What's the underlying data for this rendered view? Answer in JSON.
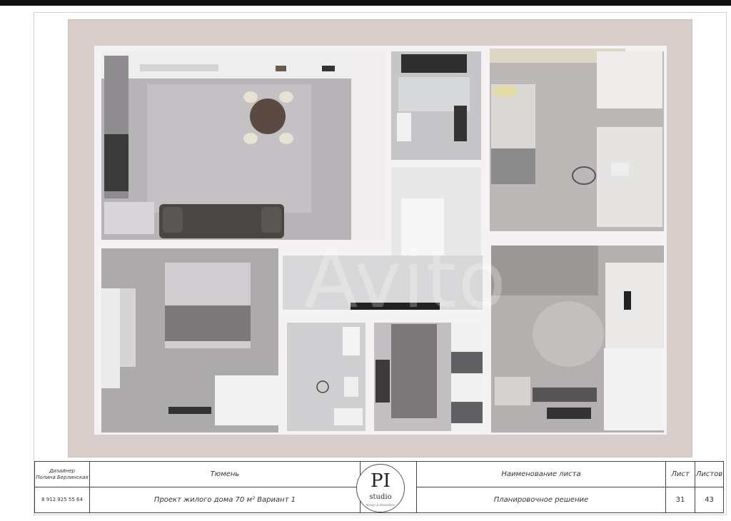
{
  "watermark": "Avito",
  "title_block": {
    "designer_role": "Дизайнер",
    "designer_name": "Полина Берлинская",
    "designer_phone": "8 912 925 55 64",
    "city": "Тюмень",
    "project": "Проект жилого дома 70 м² Вариант 1",
    "sheet_name_label": "Наименование листа",
    "sheet_name": "Планировочное решение",
    "sheet_label": "Лист",
    "sheet_number": "31",
    "sheets_label": "Листов",
    "sheets_total": "43"
  },
  "logo": {
    "main": "PI",
    "sub": "studio",
    "tagline": "design & decoration"
  },
  "colors": {
    "frame_bg": "#d8cfcc",
    "wall": "#f3f1f2",
    "floor": "#b9b7b9",
    "carpet": "#a9a8ab",
    "sofa": "#4a4644"
  }
}
